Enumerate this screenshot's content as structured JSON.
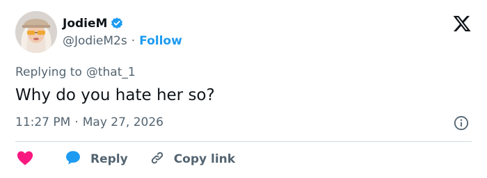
{
  "author": {
    "name": "JodieM",
    "handle": "@JodieM2s",
    "separator": "·",
    "follow_label": "Follow"
  },
  "reply_context": {
    "prefix": "Replying to",
    "mention": "@that_1"
  },
  "tweet": {
    "text": "Why do you hate her so?",
    "time": "11:27 PM",
    "separator": "·",
    "date": "May 27, 2026"
  },
  "actions": {
    "reply_label": "Reply",
    "copy_link_label": "Copy link"
  },
  "icons": {
    "brand": "x-logo-icon",
    "verified": "verified-badge-icon",
    "info": "info-icon",
    "like": "heart-icon",
    "reply": "reply-bubble-icon",
    "copy": "link-icon"
  },
  "colors": {
    "text": "#0f1419",
    "muted": "#536471",
    "accent": "#1d9bf0",
    "like": "#f91880",
    "divider": "#cfd9de"
  }
}
